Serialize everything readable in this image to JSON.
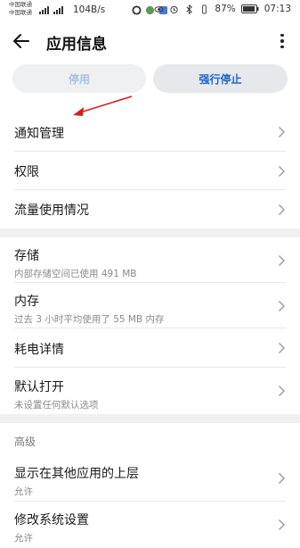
{
  "status_bar": {
    "carrier1": "中国联通",
    "carrier2": "中国联通",
    "net_speed": "104B/s",
    "battery_pct": "87%",
    "time": "07:13"
  },
  "header": {
    "title": "应用信息"
  },
  "actions": {
    "disable_label": "停用",
    "force_stop_label": "强行停止"
  },
  "list_group1": [
    {
      "label": "通知管理"
    },
    {
      "label": "权限"
    },
    {
      "label": "流量使用情况"
    }
  ],
  "list_group2": [
    {
      "label": "存储",
      "sub": "内部存储空间已使用 491 MB"
    },
    {
      "label": "内存",
      "sub": "过去 3 小时平均使用了 55 MB 内存"
    },
    {
      "label": "耗电详情"
    },
    {
      "label": "默认打开",
      "sub": "未设置任何默认选项"
    }
  ],
  "section_advanced": {
    "header": "高级",
    "items": [
      {
        "label": "显示在其他应用的上层",
        "sub": "允许"
      },
      {
        "label": "修改系统设置",
        "sub": "允许"
      }
    ]
  },
  "colors": {
    "accent": "#1c65c9",
    "annotation_arrow": "#d22121"
  }
}
